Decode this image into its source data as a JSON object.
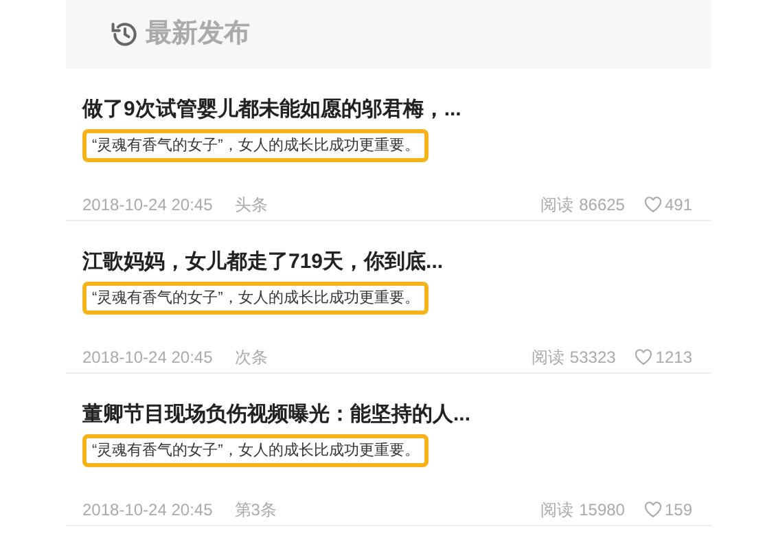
{
  "header": {
    "title": "最新发布"
  },
  "articles": [
    {
      "title": "做了9次试管婴儿都未能如愿的邬君梅，...",
      "subtitle": "“灵魂有香气的女子”，女人的成长比成功更重要。",
      "time": "2018-10-24 20:45",
      "position": "头条",
      "reads_label": "阅读",
      "reads": "86625",
      "likes": "491"
    },
    {
      "title": "江歌妈妈，女儿都走了719天，你到底...",
      "subtitle": "“灵魂有香气的女子”，女人的成长比成功更重要。",
      "time": "2018-10-24 20:45",
      "position": "次条",
      "reads_label": "阅读",
      "reads": "53323",
      "likes": "1213"
    },
    {
      "title": "董卿节目现场负伤视频曝光：能坚持的人...",
      "subtitle": "“灵魂有香气的女子”，女人的成长比成功更重要。",
      "time": "2018-10-24 20:45",
      "position": "第3条",
      "reads_label": "阅读",
      "reads": "15980",
      "likes": "159"
    }
  ]
}
